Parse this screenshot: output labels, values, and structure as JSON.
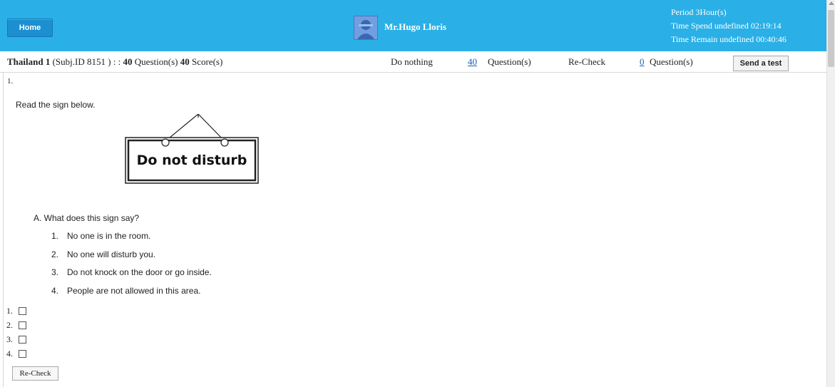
{
  "header": {
    "home_label": "Home",
    "user_name": "Mr.Hugo Lloris",
    "period": "Period 3Hour(s)",
    "time_spend": "Time Spend undefined 02:19:14",
    "time_remain": "Time Remain undefined 00:40:46"
  },
  "subbar": {
    "subject_name": "Thailand 1",
    "subject_id": "(Subj.ID 8151 ) : :",
    "question_count": "40",
    "question_label": "Question(s)",
    "score_count": "40",
    "score_label": "Score(s)",
    "status1_label": "Do nothing",
    "status1_count": "40",
    "status1_unit": "Question(s)",
    "status2_label": "Re-Check",
    "status2_count": "0",
    "status2_unit": "Question(s)",
    "send_label": "Send a test"
  },
  "question": {
    "number": "1.",
    "prompt": "Read the sign below.",
    "sign_text": "Do not disturb",
    "sub_question": "A.  What does this sign say?",
    "options": [
      {
        "n": "1.",
        "text": "No one is in the room."
      },
      {
        "n": "2.",
        "text": "No one will disturb you."
      },
      {
        "n": "3.",
        "text": "Do not knock on the door or go inside."
      },
      {
        "n": "4.",
        "text": "People are not allowed in this area."
      }
    ],
    "answers": [
      "1.",
      "2.",
      "3.",
      "4."
    ],
    "recheck_label": "Re-Check"
  }
}
